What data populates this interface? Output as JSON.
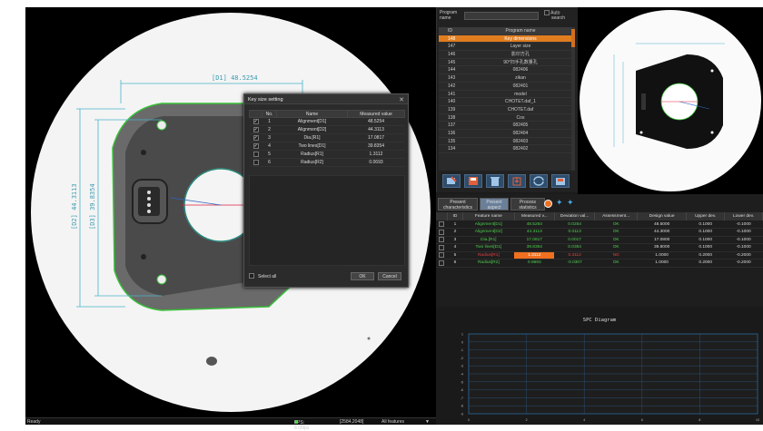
{
  "status": {
    "left": "Ready",
    "fps": "FPS: 8.05fps",
    "resolution": "[2584,2048]",
    "feature_filter": "All features",
    "dropdown": "▼"
  },
  "viewport": {
    "dim_top": "[D1] 48.5254",
    "dim_left_outer": "[D2] 44.3113",
    "dim_left_inner": "[D3] 39.8354"
  },
  "dialog": {
    "title": "Key size setting",
    "close": "✕",
    "columns": [
      "No.",
      "Name",
      "Measured value"
    ],
    "rows": [
      {
        "checked": true,
        "no": "1",
        "name": "Alignment[D1]",
        "value": "48.5254"
      },
      {
        "checked": true,
        "no": "2",
        "name": "Alignment[D2]",
        "value": "44.3113"
      },
      {
        "checked": true,
        "no": "3",
        "name": "Dia.[R1]",
        "value": "17.0817"
      },
      {
        "checked": true,
        "no": "4",
        "name": "Two lines[D1]",
        "value": "39.8354"
      },
      {
        "checked": false,
        "no": "5",
        "name": "Radius[R1]",
        "value": "1.3112"
      },
      {
        "checked": false,
        "no": "6",
        "name": "Radius[R2]",
        "value": "0.0693"
      }
    ],
    "select_all": "Select all",
    "ok": "OK",
    "cancel": "Cancel"
  },
  "program": {
    "label_line1": "Program",
    "label_line2": "name",
    "auto_line1": "Auto",
    "auto_line2": "search",
    "columns": [
      "ID",
      "Program name"
    ],
    "rows": [
      {
        "id": "148",
        "name": "Key dimensions",
        "selected": true
      },
      {
        "id": "147",
        "name": "Layer size"
      },
      {
        "id": "146",
        "name": "影印方孔"
      },
      {
        "id": "145",
        "name": "90°扫手孔数量孔"
      },
      {
        "id": "144",
        "name": "082406"
      },
      {
        "id": "143",
        "name": "zikan"
      },
      {
        "id": "142",
        "name": "082401"
      },
      {
        "id": "141",
        "name": "model"
      },
      {
        "id": "140",
        "name": "CHOTET.daf_1"
      },
      {
        "id": "139",
        "name": "CHOTET.daf"
      },
      {
        "id": "138",
        "name": "Cos"
      },
      {
        "id": "137",
        "name": "082405"
      },
      {
        "id": "136",
        "name": "082404"
      },
      {
        "id": "135",
        "name": "082403"
      },
      {
        "id": "134",
        "name": "082402"
      }
    ]
  },
  "tabs": [
    {
      "line1": "Present",
      "line2": "characteristics"
    },
    {
      "line1": "Present",
      "line2": "aspect",
      "active": true
    },
    {
      "line1": "Process",
      "line2": "statistics"
    }
  ],
  "measurements": {
    "columns": [
      "",
      "ID",
      "Feature name",
      "Measured v...",
      "Deviation val...",
      "Assessment...",
      "Design value",
      "Upper dev.",
      "Lower dev."
    ],
    "rows": [
      {
        "id": "1",
        "name": "Alignment[D1]",
        "measured": "48.5254",
        "deviation": "0.0254",
        "assessment": "OK",
        "design": "48.5000",
        "upper": "0.1000",
        "lower": "-0.1000",
        "status": "ok"
      },
      {
        "id": "2",
        "name": "Alignment[D2]",
        "measured": "44.3113",
        "deviation": "0.0113",
        "assessment": "OK",
        "design": "44.3000",
        "upper": "0.1000",
        "lower": "-0.1000",
        "status": "ok"
      },
      {
        "id": "3",
        "name": "Dia.[R1]",
        "measured": "17.0817",
        "deviation": "0.0017",
        "assessment": "OK",
        "design": "17.0800",
        "upper": "0.1000",
        "lower": "-0.1000",
        "status": "ok"
      },
      {
        "id": "4",
        "name": "Two lines[D1]",
        "measured": "39.8354",
        "deviation": "0.0354",
        "assessment": "OK",
        "design": "39.8000",
        "upper": "0.1000",
        "lower": "-0.1000",
        "status": "ok"
      },
      {
        "id": "5",
        "name": "Radius[R1]",
        "measured": "1.3112",
        "deviation": "0.3112",
        "assessment": "NG",
        "design": "1.0000",
        "upper": "0.2000",
        "lower": "-0.2000",
        "status": "ng"
      },
      {
        "id": "6",
        "name": "Radius[R2]",
        "measured": "0.9693",
        "deviation": "-0.0307",
        "assessment": "OK",
        "design": "1.0000",
        "upper": "0.2000",
        "lower": "-0.2000",
        "status": "ok"
      }
    ]
  },
  "spc": {
    "title": "SPC Diagram",
    "y_ticks": [
      "1",
      "0",
      "-1",
      "-2",
      "-3",
      "-4",
      "-5",
      "-6",
      "-7",
      "-8",
      "-9"
    ],
    "x_ticks": [
      "0",
      "2",
      "4",
      "6",
      "8",
      "10"
    ]
  },
  "colors": {
    "accent": "#e07d1f",
    "ok": "#4fcf4f",
    "ng": "#e84040",
    "dim_line": "#4bb3c8"
  }
}
